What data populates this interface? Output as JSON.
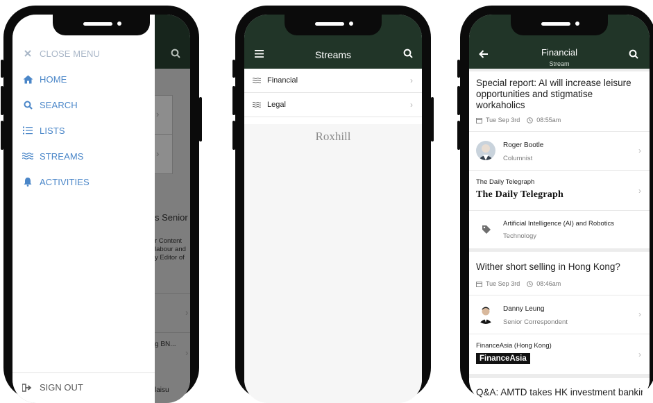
{
  "phone1": {
    "menu": [
      {
        "label": "CLOSE MENU",
        "icon": "close-icon"
      },
      {
        "label": "HOME",
        "icon": "home-icon"
      },
      {
        "label": "SEARCH",
        "icon": "search-icon"
      },
      {
        "label": "LISTS",
        "icon": "list-icon"
      },
      {
        "label": "STREAMS",
        "icon": "streams-icon"
      },
      {
        "label": "ACTIVITIES",
        "icon": "bell-icon"
      }
    ],
    "sign_out": "SIGN OUT",
    "background_text": {
      "headline_fragment": "s Senior",
      "body_lines": [
        "r Content",
        "labour and",
        "y Editor of"
      ],
      "item_fragment": "g BN...",
      "bottom_fragment": "laisu"
    }
  },
  "phone2": {
    "title": "Streams",
    "rows": [
      {
        "label": "Financial"
      },
      {
        "label": "Legal"
      }
    ],
    "brand": "Roxhill"
  },
  "phone3": {
    "title": "Financial",
    "subtitle": "Stream",
    "articles": [
      {
        "headline": "Special report: AI will increase leisure opportunities and stigmatise workaholics",
        "date": "Tue Sep 3rd",
        "time": "08:55am",
        "author": {
          "name": "Roger Bootle",
          "role": "Columnist"
        },
        "publication": {
          "name": "The Daily Telegraph",
          "logo_text": "The Daily Telegraph"
        },
        "topic": {
          "name": "Artificial Intelligence (AI) and Robotics",
          "category": "Technology"
        }
      },
      {
        "headline": "Wither short selling in Hong Kong?",
        "date": "Tue Sep 3rd",
        "time": "08:46am",
        "author": {
          "name": "Danny Leung",
          "role": "Senior Correspondent"
        },
        "publication": {
          "name": "FinanceAsia (Hong Kong)",
          "logo_text": "FinanceAsia"
        }
      },
      {
        "headline": "Q&A: AMTD takes HK investment banking"
      }
    ]
  },
  "colors": {
    "appbar": "#213528",
    "menu_link": "#4a86c8",
    "overlay": "#7e7e7e"
  }
}
